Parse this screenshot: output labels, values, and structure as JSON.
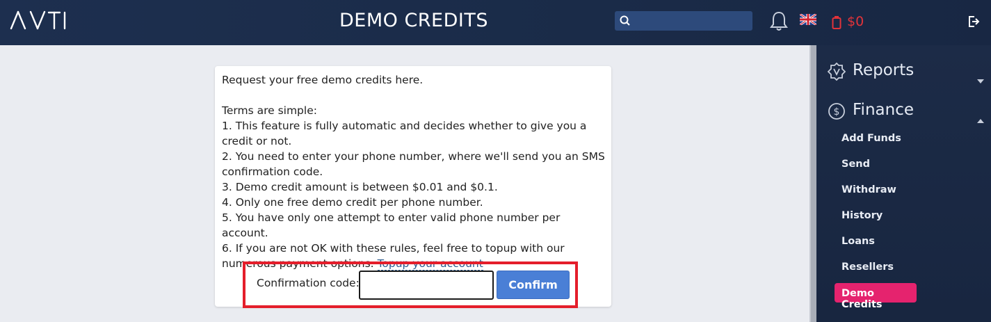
{
  "header": {
    "logo_text": "AVTI",
    "title": "DEMO CREDITS",
    "search": {
      "placeholder": "",
      "value": ""
    },
    "balance": "$0",
    "icons": [
      "search-icon",
      "bell-icon",
      "uk-flag-icon",
      "wallet-icon",
      "logout-icon"
    ]
  },
  "card": {
    "intro": "Request your free demo credits here.",
    "terms_heading": "Terms are simple:",
    "terms": [
      "1. This feature is fully automatic and decides whether to give you a credit or not.",
      "2. You need to enter your phone number, where we'll send you an SMS confirmation code.",
      "3. Demo credit amount is between $0.01 and $0.1.",
      "4. Only one free demo credit per phone number.",
      "5. You have only one attempt to enter valid phone number per account.",
      "6. If you are not OK with these rules, feel free to topup with our numerous payment options."
    ],
    "topup_link": "Topup your account"
  },
  "form": {
    "label": "Confirmation code:",
    "input_value": "",
    "confirm_button": "Confirm"
  },
  "sidebar": {
    "sections": [
      {
        "label": "Reports",
        "icon": "reports-icon",
        "expanded": false
      },
      {
        "label": "Finance",
        "icon": "dollar-icon",
        "expanded": true
      }
    ],
    "finance_items": [
      "Add Funds",
      "Send",
      "Withdraw",
      "History",
      "Loans",
      "Resellers"
    ],
    "active_item": "Demo Credits"
  },
  "colors": {
    "header_bg": "#1d2f4f",
    "accent_active": "#e5236e",
    "balance": "#e2333a",
    "confirm_button": "#4a7fd6",
    "highlight_frame": "#e41e2b"
  }
}
